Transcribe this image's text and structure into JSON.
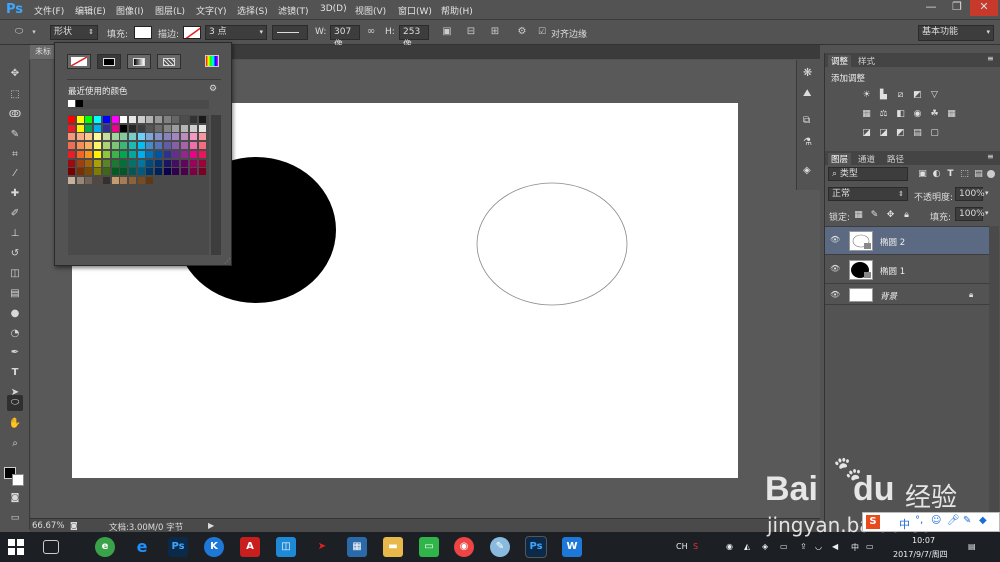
{
  "app": {
    "logo": "Ps"
  },
  "menu": [
    "文件(F)",
    "编辑(E)",
    "图像(I)",
    "图层(L)",
    "文字(Y)",
    "选择(S)",
    "滤镜(T)",
    "3D(D)",
    "视图(V)",
    "窗口(W)",
    "帮助(H)"
  ],
  "window_controls": {
    "minimize": "—",
    "restore": "❐",
    "close": "✕"
  },
  "options": {
    "mode": "形状",
    "fill_label": "填充:",
    "stroke_label": "描边:",
    "stroke_width": "3 点",
    "w_label": "W:",
    "w_value": "307 像",
    "h_label": "H:",
    "h_value": "253 像",
    "align_edges": "对齐边缘",
    "workspace": "基本功能"
  },
  "document": {
    "tab": "未标"
  },
  "status": {
    "zoom": "66.67%",
    "doc_info": "文档:3.00M/0 字节"
  },
  "color_popup": {
    "recent_label": "最近使用的颜色",
    "recent_colors": [
      "#ffffff",
      "#000000"
    ],
    "swatches": [
      [
        "#ff0000",
        "#ffff00",
        "#00ff00",
        "#00ffff",
        "#0000ff",
        "#ff00ff",
        "#ffffff",
        "#e6e6e6",
        "#cccccc",
        "#b3b3b3",
        "#999999",
        "#808080",
        "#666666",
        "#4d4d4d",
        "#333333",
        "#1a1a1a"
      ],
      [
        "#ed1c24",
        "#fff200",
        "#00a651",
        "#00aeef",
        "#2e3192",
        "#ec008c",
        "#000000",
        "#262626",
        "#3d3d3d",
        "#555555",
        "#6d6d6d",
        "#858585",
        "#9d9d9d",
        "#b5b5b5",
        "#cdcdcd",
        "#e5e5e5"
      ],
      [
        "#f7977a",
        "#f9ad81",
        "#fdc68a",
        "#fff79a",
        "#c4df9b",
        "#a3d39c",
        "#82ca9d",
        "#7accc8",
        "#6dcff6",
        "#7da7d9",
        "#8393ca",
        "#8781bd",
        "#a187be",
        "#bd8cbf",
        "#f49ac2",
        "#f6989d"
      ],
      [
        "#f26c4f",
        "#f68e55",
        "#fbaf5c",
        "#fff467",
        "#acd372",
        "#7cc576",
        "#3bb878",
        "#1abbb4",
        "#00bff3",
        "#438cca",
        "#5574b9",
        "#605ca8",
        "#855fa8",
        "#a763a8",
        "#f06ea9",
        "#f26d7d"
      ],
      [
        "#ed1c24",
        "#f26522",
        "#f7941d",
        "#fff200",
        "#8dc63f",
        "#39b54a",
        "#00a651",
        "#00a99d",
        "#00aeef",
        "#0072bc",
        "#0054a6",
        "#2e3192",
        "#662d91",
        "#92278f",
        "#ec008c",
        "#ed145b"
      ],
      [
        "#9e0b0f",
        "#a0410d",
        "#a36209",
        "#aba000",
        "#598527",
        "#1a7b30",
        "#007236",
        "#00746b",
        "#0076a3",
        "#004b80",
        "#003471",
        "#1b1464",
        "#440e62",
        "#630460",
        "#9e005d",
        "#9e0039"
      ],
      [
        "#790000",
        "#7b2e00",
        "#7d4900",
        "#827b00",
        "#406618",
        "#005e20",
        "#005826",
        "#005952",
        "#005b7f",
        "#003663",
        "#002157",
        "#0d004c",
        "#32004b",
        "#4b0049",
        "#7b0046",
        "#7a0026"
      ],
      [
        "#c7b299",
        "#998675",
        "#736357",
        "#534741",
        "#362f2d",
        "#c69c6d",
        "#a67c52",
        "#8c6239",
        "#754c24",
        "#603913"
      ]
    ]
  },
  "panels": {
    "adjust_tab": "调整",
    "style_tab": "样式",
    "add_adjust": "添加调整",
    "layers_tab": "图层",
    "channels_tab": "通道",
    "paths_tab": "路径",
    "kind_filter": "类型",
    "blend_mode": "正常",
    "opacity_label": "不透明度:",
    "opacity_value": "100%",
    "lock_label": "锁定:",
    "fill_label": "填充:",
    "fill_value": "100%",
    "layers": [
      {
        "name": "椭圆 2",
        "selected": true
      },
      {
        "name": "椭圆 1",
        "selected": false
      },
      {
        "name": "背景",
        "selected": false
      }
    ]
  },
  "taskbar": {
    "time": "10:07",
    "date": "2017/9/7/周四",
    "lang": "CH",
    "ime": "中"
  },
  "watermark": {
    "brand": "Bai",
    "brand2": "du",
    "cn": "经验",
    "url": "jingyan.baidu.com"
  }
}
